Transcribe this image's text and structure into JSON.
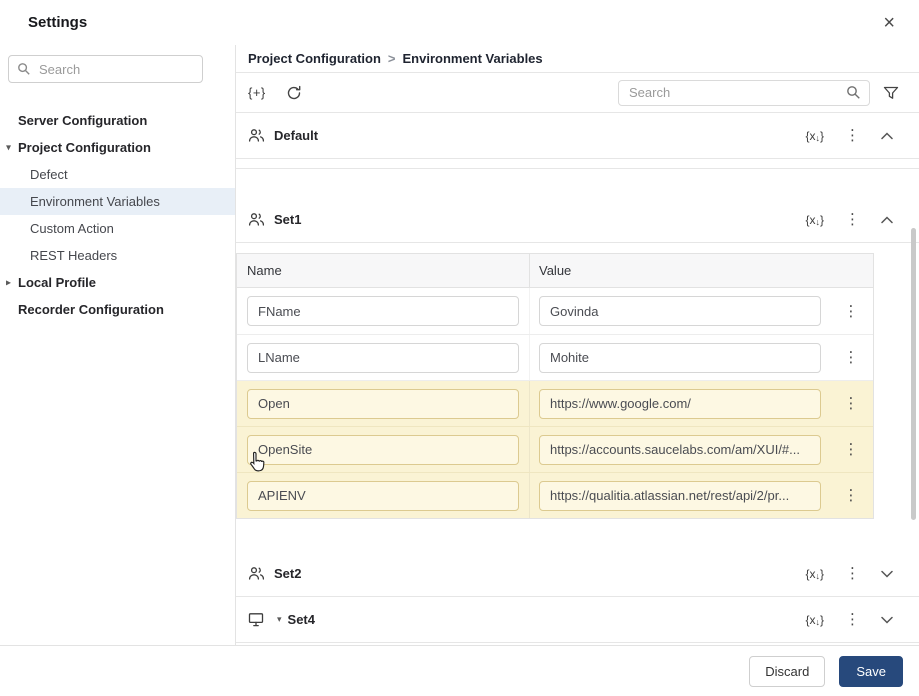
{
  "window": {
    "title": "Settings"
  },
  "icons": {
    "close": "×",
    "add_set": "{+}",
    "kebab": "⋮",
    "vx_open": "{x",
    "vx_arrow": "↓",
    "vx_close": "}",
    "caret_expanded": "▾",
    "caret_collapsed": "▸",
    "monitor_caret": "▾"
  },
  "sidebar": {
    "search_placeholder": "Search",
    "items": [
      {
        "label": "Server Configuration"
      },
      {
        "label": "Project Configuration"
      },
      {
        "label": "Defect"
      },
      {
        "label": "Environment Variables"
      },
      {
        "label": "Custom Action"
      },
      {
        "label": "REST Headers"
      },
      {
        "label": "Local Profile"
      },
      {
        "label": "Recorder Configuration"
      }
    ]
  },
  "main": {
    "breadcrumb": {
      "parent": "Project Configuration",
      "separator": ">",
      "current": "Environment Variables"
    },
    "toolbar": {
      "search_placeholder": "Search"
    },
    "sections": {
      "default": {
        "name": "Default"
      },
      "set1": {
        "name": "Set1"
      },
      "set2": {
        "name": "Set2"
      },
      "set4": {
        "name": "Set4"
      }
    },
    "table": {
      "headers": {
        "name": "Name",
        "value": "Value"
      },
      "rows": [
        {
          "name": "FName",
          "value": "Govinda",
          "highlighted": false
        },
        {
          "name": "LName",
          "value": "Mohite",
          "highlighted": false
        },
        {
          "name": "Open",
          "value": "https://www.google.com/",
          "highlighted": true
        },
        {
          "name": "OpenSite",
          "value": "https://accounts.saucelabs.com/am/XUI/#...",
          "highlighted": true
        },
        {
          "name": "APIENV",
          "value": "https://qualitia.atlassian.net/rest/api/2/pr...",
          "highlighted": true
        }
      ]
    }
  },
  "footer": {
    "discard": "Discard",
    "save": "Save"
  },
  "colors": {
    "save_button": "#27497c",
    "selected_nav": "#e8eff7",
    "row_highlight": "#faf3d4",
    "breadcrumb_text": "#1f2430"
  }
}
